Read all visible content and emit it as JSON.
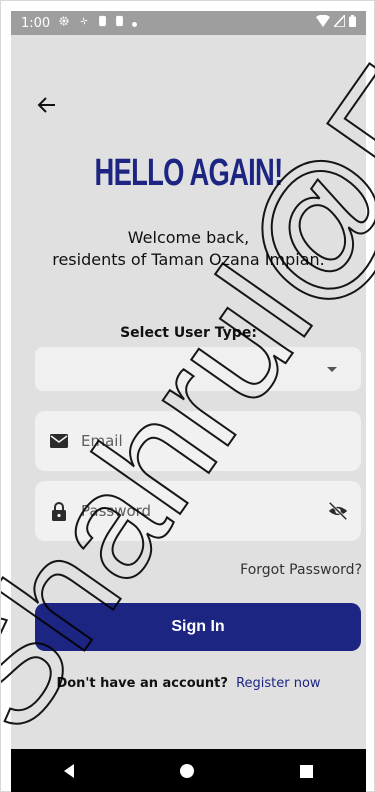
{
  "status_bar": {
    "time": "1:00",
    "left_icons": [
      "gear-icon",
      "fan-icon",
      "person-icon",
      "person-icon",
      "dot-icon"
    ],
    "right_icons": [
      "wifi-icon",
      "signal-icon",
      "battery-icon"
    ]
  },
  "header": {
    "back_icon": "arrow-left-icon"
  },
  "main": {
    "title": "HELLO AGAIN!",
    "welcome_line1": "Welcome back,",
    "welcome_line2": "residents of Taman Ozana Impian.",
    "select_label": "Select User Type:",
    "select_value": "",
    "email_placeholder": "Email",
    "password_placeholder": "Password",
    "forgot_password": "Forgot Password?",
    "signin_label": "Sign In",
    "no_account_text": "Don't have an account?",
    "register_link": "Register now"
  },
  "colors": {
    "primary": "#1d2582",
    "background": "#e0e0e0",
    "field": "#f1f1f1"
  },
  "watermark_text": "Shahrul@FM"
}
